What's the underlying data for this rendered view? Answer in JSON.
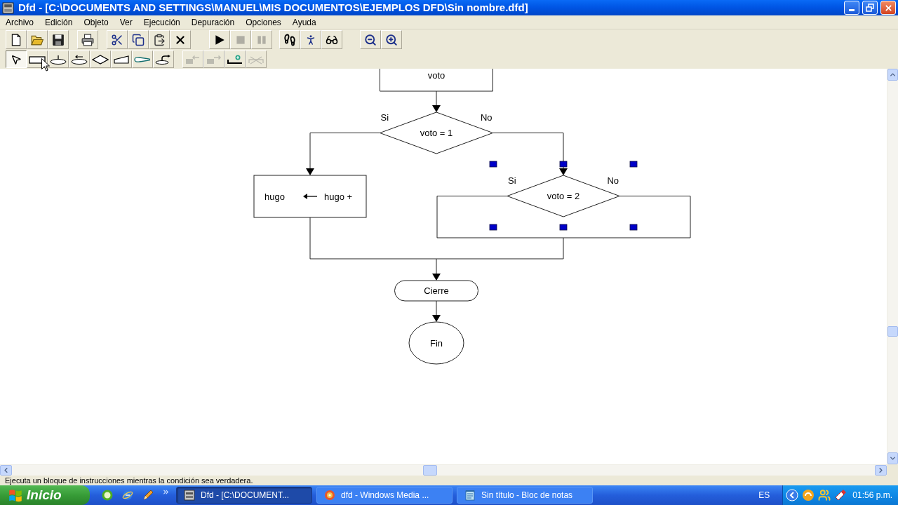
{
  "window": {
    "title": "Dfd - [C:\\DOCUMENTS AND SETTINGS\\MANUEL\\MIS DOCUMENTOS\\EJEMPLOS DFD\\Sin nombre.dfd]"
  },
  "menu": [
    "Archivo",
    "Edición",
    "Objeto",
    "Ver",
    "Ejecución",
    "Depuración",
    "Opciones",
    "Ayuda"
  ],
  "toolbar_1": [
    [
      {
        "kind": "page",
        "disabled": false
      },
      {
        "kind": "folder",
        "disabled": false
      },
      {
        "kind": "floppy",
        "disabled": false
      }
    ],
    [
      {
        "kind": "printer",
        "disabled": false
      }
    ],
    [
      {
        "kind": "scissors",
        "disabled": false
      },
      {
        "kind": "copy",
        "disabled": false
      },
      {
        "kind": "paste",
        "disabled": false
      },
      {
        "kind": "cross",
        "disabled": false
      }
    ],
    [
      {
        "kind": "play",
        "disabled": false
      },
      {
        "kind": "stop",
        "disabled": true
      },
      {
        "kind": "pause",
        "disabled": true
      }
    ],
    [
      {
        "kind": "footprints",
        "disabled": false
      },
      {
        "kind": "figure",
        "disabled": false
      },
      {
        "kind": "glasses",
        "disabled": false
      }
    ],
    [
      {
        "kind": "zoom_out",
        "disabled": false
      },
      {
        "kind": "zoom_in",
        "disabled": false
      }
    ]
  ],
  "toolbar_2": [
    [
      {
        "kind": "pointer",
        "selected": true,
        "disabled": false
      },
      {
        "kind": "rectangle",
        "selected": false,
        "disabled": false
      },
      {
        "kind": "ellipse_mark",
        "selected": false,
        "disabled": false
      },
      {
        "kind": "ellipse_arrow",
        "selected": false,
        "disabled": false
      },
      {
        "kind": "diamond",
        "selected": false,
        "disabled": false
      },
      {
        "kind": "trapezoid",
        "selected": false,
        "disabled": false
      },
      {
        "kind": "cone",
        "selected": false,
        "disabled": false
      },
      {
        "kind": "curved_arrow",
        "selected": false,
        "disabled": false
      }
    ],
    [
      {
        "kind": "block_left",
        "selected": false,
        "disabled": true
      },
      {
        "kind": "block_right",
        "selected": false,
        "disabled": true
      },
      {
        "kind": "bracket_plus",
        "selected": false,
        "disabled": false
      },
      {
        "kind": "crossed",
        "selected": false,
        "disabled": true
      }
    ]
  ],
  "flowchart": {
    "nodes": [
      {
        "kind": "process",
        "text": "voto",
        "selected": false
      },
      {
        "kind": "decision",
        "text": "voto = 1",
        "yes": "Si",
        "no": "No",
        "selected": false
      },
      {
        "kind": "assignment",
        "variable": "hugo",
        "expression": "hugo +",
        "selected": false
      },
      {
        "kind": "decision",
        "text": "voto = 2",
        "yes": "Si",
        "no": "No",
        "selected": true
      },
      {
        "kind": "terminal",
        "text": "Cierre",
        "selected": false
      },
      {
        "kind": "end",
        "text": "Fin",
        "selected": false
      }
    ]
  },
  "status_bar": "Ejecuta un bloque de instrucciones mientras la condición sea verdadera.",
  "taskbar": {
    "start": "Inicio",
    "tasks": [
      {
        "label": "Dfd - [C:\\DOCUMENT...",
        "selected": true
      },
      {
        "label": "dfd - Windows Media ...",
        "selected": false
      },
      {
        "label": "Sin título - Bloc de notas",
        "selected": false
      }
    ],
    "language": "ES",
    "clock": "01:56 p.m."
  }
}
